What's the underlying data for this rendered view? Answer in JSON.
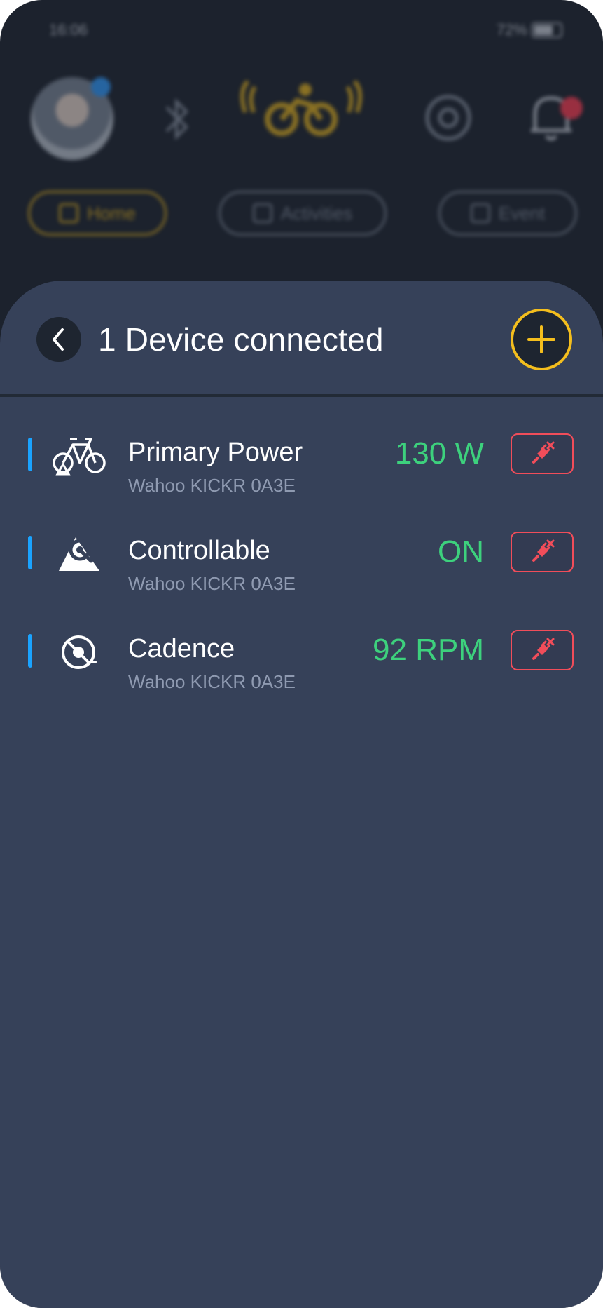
{
  "status_bar": {
    "time": "16:06",
    "battery": "72%"
  },
  "background_tabs": [
    {
      "label": "Home",
      "active": true
    },
    {
      "label": "Activities",
      "active": false
    },
    {
      "label": "Event",
      "active": false
    }
  ],
  "sheet": {
    "title": "1 Device connected",
    "back_icon": "chevron-left-icon",
    "add_icon": "plus-icon"
  },
  "devices": [
    {
      "name": "Primary Power",
      "device": "Wahoo KICKR 0A3E",
      "value": "130 W",
      "icon": "bicycle-icon"
    },
    {
      "name": "Controllable",
      "device": "Wahoo KICKR 0A3E",
      "value": "ON",
      "icon": "controllable-icon"
    },
    {
      "name": "Cadence",
      "device": "Wahoo KICKR 0A3E",
      "value": "92 RPM",
      "icon": "cadence-icon"
    }
  ],
  "colors": {
    "sheet_bg": "#364159",
    "accent_yellow": "#f4be1d",
    "value_green": "#3dd17d",
    "disconnect_red": "#f14d5a",
    "indicator_blue": "#1aa3ff"
  }
}
